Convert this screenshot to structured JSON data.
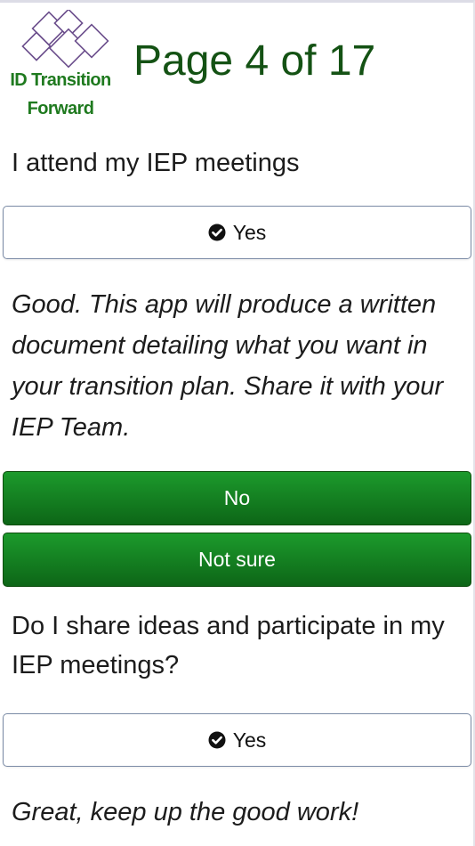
{
  "header": {
    "logo_line1": "ID Transition",
    "logo_line2": "Forward",
    "page_title": "Page 4 of 17"
  },
  "question1": {
    "text": "I attend my IEP meetings",
    "selected_answer": "Yes",
    "feedback": "Good. This app will produce a written document detailing what you want in your transition plan. Share it with your IEP Team.",
    "other_options": [
      "No",
      "Not sure"
    ]
  },
  "question2": {
    "text": "Do I share ideas and participate in my IEP meetings?",
    "selected_answer": "Yes",
    "feedback": "Great, keep up the good work!"
  },
  "colors": {
    "brand_green": "#1f7a1f",
    "title_green": "#145214",
    "button_green": "#14802a",
    "logo_outline": "#6b4e8c"
  },
  "icons": {
    "selected_check": "check-circle-icon"
  }
}
